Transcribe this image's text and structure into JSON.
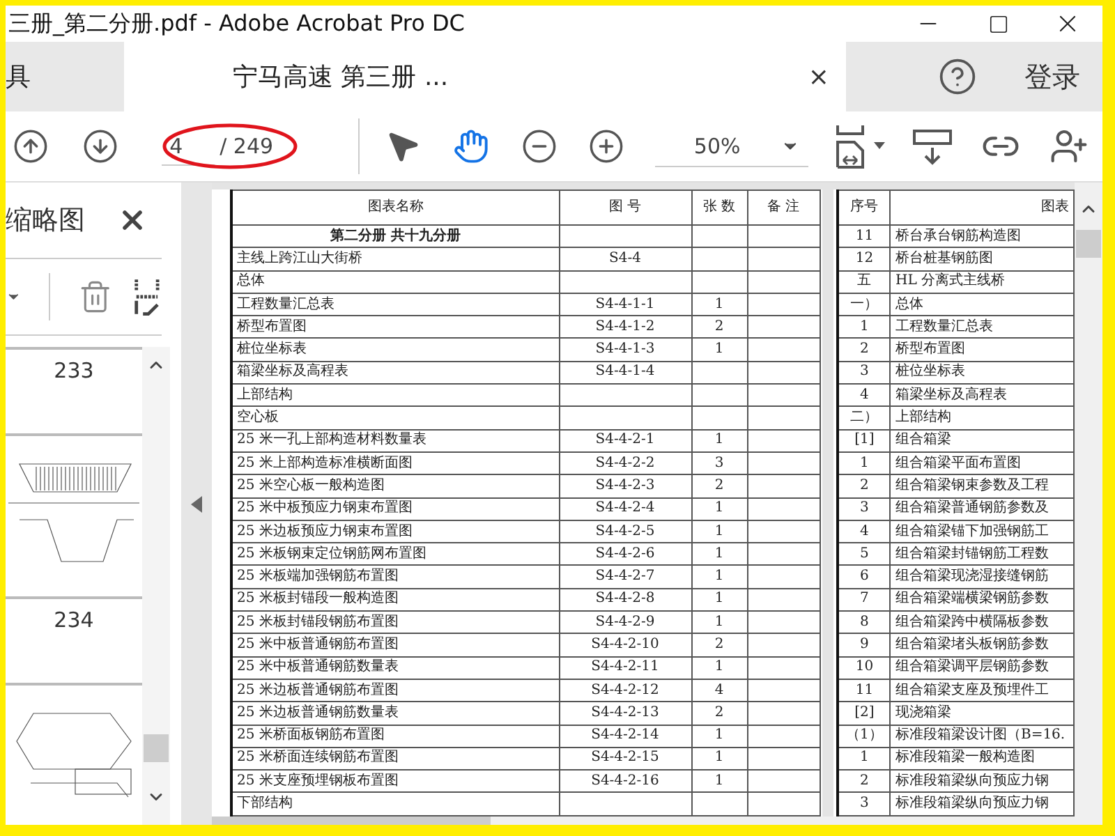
{
  "window": {
    "title": "三册_第二分册.pdf - Adobe Acrobat Pro DC"
  },
  "tabs": [
    {
      "label": "具",
      "selected": false
    },
    {
      "label": "宁马高速 第三册  ...",
      "selected": true,
      "close": "×"
    }
  ],
  "header_right": {
    "login": "登录"
  },
  "toolbar": {
    "page_current": "4",
    "page_total": "/ 249",
    "zoom": "50%",
    "modes": [
      {
        "kind": "select",
        "selected": false
      },
      {
        "kind": "hand",
        "selected": true
      }
    ]
  },
  "thumbnails_panel": {
    "title": "缩略图",
    "pages": [
      {
        "label": "233"
      },
      {
        "label": "234"
      }
    ]
  },
  "document": {
    "left_table": {
      "columns": [
        "图表名称",
        "图 号",
        "张 数",
        "备 注"
      ],
      "rows": [
        {
          "kind": "title",
          "name": "第二分册 共十九分册",
          "code": "",
          "count": ""
        },
        {
          "kind": "item",
          "name": "主线上跨江山大街桥",
          "code": "S4-4",
          "count": ""
        },
        {
          "kind": "item",
          "name": "总体",
          "code": "",
          "count": ""
        },
        {
          "kind": "item",
          "name": "工程数量汇总表",
          "code": "S4-4-1-1",
          "count": "1"
        },
        {
          "kind": "item",
          "name": "桥型布置图",
          "code": "S4-4-1-2",
          "count": "2"
        },
        {
          "kind": "item",
          "name": "桩位坐标表",
          "code": "S4-4-1-3",
          "count": "1"
        },
        {
          "kind": "item",
          "name": "箱梁坐标及高程表",
          "code": "S4-4-1-4",
          "count": ""
        },
        {
          "kind": "item",
          "name": "上部结构",
          "code": "",
          "count": ""
        },
        {
          "kind": "item",
          "name": "空心板",
          "code": "",
          "count": ""
        },
        {
          "kind": "item",
          "name": "25 米一孔上部构造材料数量表",
          "code": "S4-4-2-1",
          "count": "1"
        },
        {
          "kind": "item",
          "name": "25 米上部构造标准横断面图",
          "code": "S4-4-2-2",
          "count": "3"
        },
        {
          "kind": "item",
          "name": "25 米空心板一般构造图",
          "code": "S4-4-2-3",
          "count": "2"
        },
        {
          "kind": "item",
          "name": "25 米中板预应力钢束布置图",
          "code": "S4-4-2-4",
          "count": "1"
        },
        {
          "kind": "item",
          "name": "25 米边板预应力钢束布置图",
          "code": "S4-4-2-5",
          "count": "1"
        },
        {
          "kind": "item",
          "name": "25 米板钢束定位钢筋网布置图",
          "code": "S4-4-2-6",
          "count": "1"
        },
        {
          "kind": "item",
          "name": "25 米板端加强钢筋布置图",
          "code": "S4-4-2-7",
          "count": "1"
        },
        {
          "kind": "item",
          "name": "25 米板封锚段一般构造图",
          "code": "S4-4-2-8",
          "count": "1"
        },
        {
          "kind": "item",
          "name": "25 米板封锚段钢筋布置图",
          "code": "S4-4-2-9",
          "count": "1"
        },
        {
          "kind": "item",
          "name": "25 米中板普通钢筋布置图",
          "code": "S4-4-2-10",
          "count": "2"
        },
        {
          "kind": "item",
          "name": "25 米中板普通钢筋数量表",
          "code": "S4-4-2-11",
          "count": "1"
        },
        {
          "kind": "item",
          "name": "25 米边板普通钢筋布置图",
          "code": "S4-4-2-12",
          "count": "4"
        },
        {
          "kind": "item",
          "name": "25 米边板普通钢筋数量表",
          "code": "S4-4-2-13",
          "count": "2"
        },
        {
          "kind": "item",
          "name": "25 米桥面板钢筋布置图",
          "code": "S4-4-2-14",
          "count": "1"
        },
        {
          "kind": "item",
          "name": "25 米桥面连续钢筋布置图",
          "code": "S4-4-2-15",
          "count": "1"
        },
        {
          "kind": "item",
          "name": "25 米支座预埋钢板布置图",
          "code": "S4-4-2-16",
          "count": "1"
        },
        {
          "kind": "item",
          "name": "下部结构",
          "code": "",
          "count": ""
        }
      ]
    },
    "right_table": {
      "columns": [
        "序号",
        "图表"
      ],
      "rows": [
        [
          "11",
          "桥台承台钢筋构造图"
        ],
        [
          "12",
          "桥台桩基钢筋图"
        ],
        [
          "五",
          "HL 分离式主线桥"
        ],
        [
          "一）",
          "总体"
        ],
        [
          "1",
          "工程数量汇总表"
        ],
        [
          "2",
          "桥型布置图"
        ],
        [
          "3",
          "桩位坐标表"
        ],
        [
          "4",
          "箱梁坐标及高程表"
        ],
        [
          "二）",
          "上部结构"
        ],
        [
          "[1]",
          "组合箱梁"
        ],
        [
          "1",
          "组合箱梁平面布置图"
        ],
        [
          "2",
          "组合箱梁钢束参数及工程"
        ],
        [
          "3",
          "组合箱梁普通钢筋参数及"
        ],
        [
          "4",
          "组合箱梁锚下加强钢筋工"
        ],
        [
          "5",
          "组合箱梁封锚钢筋工程数"
        ],
        [
          "6",
          "组合箱梁现浇湿接缝钢筋"
        ],
        [
          "7",
          "组合箱梁端横梁钢筋参数"
        ],
        [
          "8",
          "组合箱梁跨中横隔板参数"
        ],
        [
          "9",
          "组合箱梁堵头板钢筋参数"
        ],
        [
          "10",
          "组合箱梁调平层钢筋参数"
        ],
        [
          "11",
          "组合箱梁支座及预埋件工"
        ],
        [
          "[2]",
          "现浇箱梁"
        ],
        [
          "（1）",
          "标准段箱梁设计图（B=16."
        ],
        [
          "1",
          "标准段箱梁一般构造图"
        ],
        [
          "2",
          "标准段箱梁纵向预应力钢"
        ],
        [
          "3",
          "标准段箱梁纵向预应力钢"
        ]
      ]
    }
  }
}
